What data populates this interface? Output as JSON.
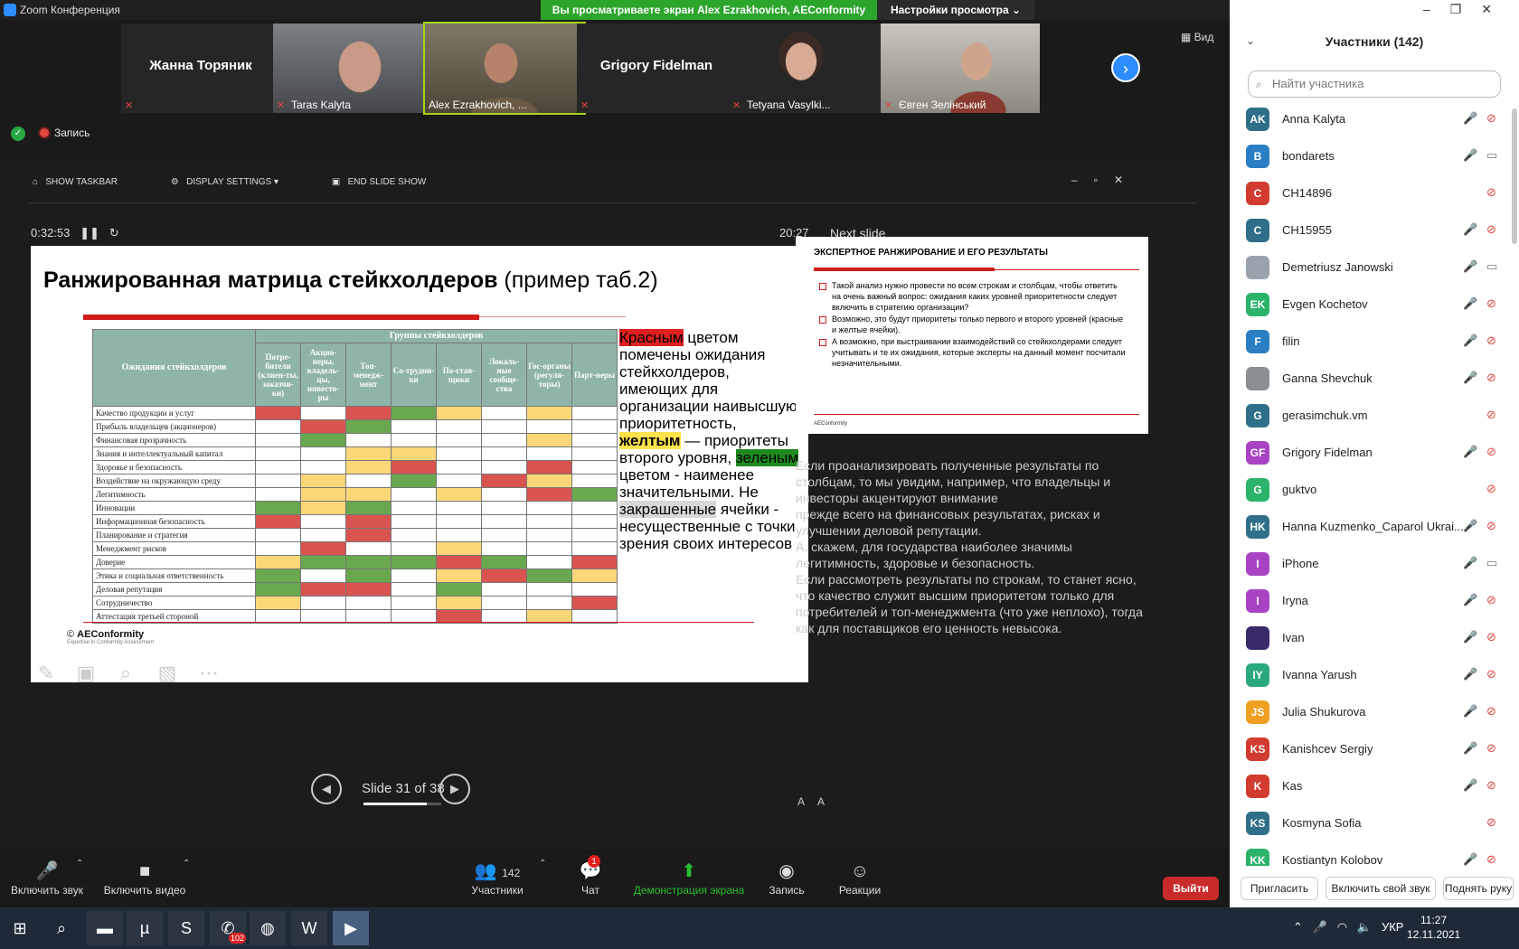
{
  "window": {
    "title": "Zoom Конференция"
  },
  "banner": {
    "viewing": "Вы просматриваете экран Alex Ezrakhovich, AEConformity",
    "view_settings": "Настройки просмотра ⌄"
  },
  "video_strip": {
    "view_label": "Вид",
    "tiles": [
      {
        "name": "Жанна Торяник",
        "caption": "",
        "type": "name"
      },
      {
        "name": "",
        "caption": "Taras Kalyta",
        "type": "photo"
      },
      {
        "name": "",
        "caption": "Alex Ezrakhovich, ...",
        "type": "photo"
      },
      {
        "name": "Grigory Fidelman",
        "caption": "",
        "type": "name"
      },
      {
        "name": "",
        "caption": "Tetyana Vasylki...",
        "type": "photo"
      },
      {
        "name": "",
        "caption": "Євген Зелінський",
        "type": "photo"
      }
    ]
  },
  "recording": {
    "label": "Запись"
  },
  "ppt_toolbar": {
    "show_taskbar": "SHOW TASKBAR",
    "display_settings": "DISPLAY SETTINGS ▾",
    "end_show": "END SLIDE SHOW"
  },
  "presenter": {
    "elapsed": "0:32:53",
    "clock": "20:27",
    "next_label": "Next slide",
    "slide_counter": "Slide 31 of 38",
    "progress": 0.816
  },
  "slide": {
    "title": "Ранжированная матрица стейкхолдеров",
    "title_sub": " (пример таб.2)",
    "table": {
      "row_header": "Ожидания стейкхолдеров",
      "group_header": "Группы стейкхолдеров",
      "columns": [
        "Потре-бители (клиен-ты, заказчи-ки)",
        "Акцио-неры, владель-цы, инвесто-ры",
        "Топ-менедж-мент",
        "Со-трудни-ки",
        "По-став-щики",
        "Локаль-ные сообще-ства",
        "Гос-органы (регуля-торы)",
        "Парт-неры"
      ],
      "rows": [
        {
          "label": "Качество продукции и услуг",
          "cells": "rwrgywyw"
        },
        {
          "label": "Прибыль владельцев (акционеров)",
          "cells": "wrgwwwww"
        },
        {
          "label": "Финансовая прозрачность",
          "cells": "wgwwwwyw"
        },
        {
          "label": "Знания и интеллектуальный капитал",
          "cells": "wwyywwww"
        },
        {
          "label": "Здоровье и безопасность",
          "cells": "wwyrwwrw"
        },
        {
          "label": "Воздействие на окружающую среду",
          "cells": "wywgwryw"
        },
        {
          "label": "Легитимность",
          "cells": "wyywywrg"
        },
        {
          "label": "Инновации",
          "cells": "gygwwwww"
        },
        {
          "label": "Информационная безопасность",
          "cells": "rwrwwwww"
        },
        {
          "label": "Планирование и стратегия",
          "cells": "wwrwwwww"
        },
        {
          "label": "Менеджмент рисков",
          "cells": "wrwwywww"
        },
        {
          "label": "Доверие",
          "cells": "ygggrgwr"
        },
        {
          "label": "Этика и социальная ответственность",
          "cells": "gwgwyrgy"
        },
        {
          "label": "Деловая репутация",
          "cells": "grrwgwww"
        },
        {
          "label": "Сотрудничество",
          "cells": "ywwwywwr"
        },
        {
          "label": "Аттестация третьей стороной",
          "cells": "wwwwrwyw"
        }
      ]
    },
    "legend": {
      "red": "Красным",
      "part1": " цветом помечены ожидания стейкхолдеров, имеющих для организации наивысшую приоритетность, ",
      "yellow": "желтым",
      "part2": " — приоритеты второго уровня, ",
      "green": "зеленым",
      "part3": " цветом - наименее значительными. Не ",
      "gray": "закрашенные",
      "part4": " ячейки - несущественные с точки зрения своих интересов"
    },
    "logo": "AEConformity",
    "logo_tag": "Expertise in Conformity Assessment",
    "logo_prefix": "©"
  },
  "next_slide": {
    "title": "ЭКСПЕРТНОЕ РАНЖИРОВАНИЕ И ЕГО РЕЗУЛЬТАТЫ",
    "bullets": [
      "Такой анализ нужно провести по всем строкам и столбцам, чтобы ответить на очень важный вопрос: ожидания каких уровней приоритетности следует включить в стратегию организации?",
      "Возможно, это будут приоритеты только первого и второго уровней (красные и желтые ячейки).",
      "А возможно, при выстраивании взаимодействий со стейкхолдерами следует учитывать и те их ожидания, которые эксперты на данный момент посчитали незначительными."
    ],
    "logo": "AEConformity"
  },
  "notes": [
    "Если проанализировать полученные результаты по столбцам, то мы увидим, например, что владельцы и инвесторы акцентируют внимание",
    "прежде всего на финансовых результатах, рисках и улучшении деловой репутации.",
    "А, скажем, для государства наиболее значимы легитимность, здоровье и безопасность.",
    "Если рассмотреть результаты по строкам, то станет ясно, что качество служит высшим приоритетом только для потребителей и топ-менеджмента (что уже неплохо), тогда как для поставщиков его ценность невысока."
  ],
  "zoom_bar": {
    "audio": "Включить звук",
    "video": "Включить видео",
    "participants": "Участники",
    "participants_count": "142",
    "chat": "Чат",
    "chat_badge": "1",
    "share": "Демонстрация экрана",
    "record": "Запись",
    "reactions": "Реакции",
    "leave": "Выйти"
  },
  "panel": {
    "title": "Участники (142)",
    "search_placeholder": "Найти участника",
    "participants": [
      {
        "initials": "AK",
        "name": "Anna Kalyta",
        "color": "#2f6f8a",
        "mic": true,
        "cam": "off"
      },
      {
        "initials": "B",
        "name": "bondarets",
        "color": "#2a7fc4",
        "mic": true,
        "cam": "on"
      },
      {
        "initials": "C",
        "name": "CH14896",
        "color": "#d23b2f",
        "mic": false,
        "cam": "off"
      },
      {
        "initials": "C",
        "name": "CH15955",
        "color": "#2f6f8a",
        "mic": true,
        "cam": "off"
      },
      {
        "initials": "",
        "name": "Demetriusz Janowski",
        "color": "#9aa3ad",
        "mic": true,
        "cam": "on"
      },
      {
        "initials": "EK",
        "name": "Evgen Kochetov",
        "color": "#2bb36b",
        "mic": true,
        "cam": "off"
      },
      {
        "initials": "F",
        "name": "filin",
        "color": "#2a7fc4",
        "mic": true,
        "cam": "off"
      },
      {
        "initials": "",
        "name": "Ganna Shevchuk",
        "color": "#8a8f94",
        "mic": true,
        "cam": "off"
      },
      {
        "initials": "G",
        "name": "gerasimchuk.vm",
        "color": "#2f6f8a",
        "mic": false,
        "cam": "off"
      },
      {
        "initials": "GF",
        "name": "Grigory Fidelman",
        "color": "#a844c4",
        "mic": true,
        "cam": "off"
      },
      {
        "initials": "G",
        "name": "guktvo",
        "color": "#2bb36b",
        "mic": false,
        "cam": "off"
      },
      {
        "initials": "HK",
        "name": "Hanna Kuzmenko_Caparol Ukrai...",
        "color": "#2f6f8a",
        "mic": true,
        "cam": "off"
      },
      {
        "initials": "I",
        "name": "iPhone",
        "color": "#a844c4",
        "mic": true,
        "cam": "on"
      },
      {
        "initials": "I",
        "name": "Iryna",
        "color": "#a844c4",
        "mic": true,
        "cam": "off"
      },
      {
        "initials": "",
        "name": "Ivan",
        "color": "#3a2a6a",
        "mic": true,
        "cam": "off"
      },
      {
        "initials": "IY",
        "name": "Ivanna Yarush",
        "color": "#2aa87f",
        "mic": true,
        "cam": "off"
      },
      {
        "initials": "JS",
        "name": "Julia Shukurova",
        "color": "#f0a020",
        "mic": true,
        "cam": "off"
      },
      {
        "initials": "KS",
        "name": "Kanishcev Sergiy",
        "color": "#d23b2f",
        "mic": true,
        "cam": "off"
      },
      {
        "initials": "K",
        "name": "Kas",
        "color": "#d23b2f",
        "mic": true,
        "cam": "off"
      },
      {
        "initials": "KS",
        "name": "Kosmyna Sofia",
        "color": "#2f6f8a",
        "mic": false,
        "cam": "off"
      },
      {
        "initials": "KK",
        "name": "Kostiantyn Kolobov",
        "color": "#2bb36b",
        "mic": true,
        "cam": "off"
      }
    ],
    "footer": {
      "invite": "Пригласить",
      "unmute_self": "Включить свой звук",
      "raise_hand": "Поднять руку"
    }
  },
  "taskbar": {
    "lang": "УКР",
    "time": "11:27",
    "date": "12.11.2021",
    "viber_badge": "102"
  },
  "colors": {
    "zoom_blue": "#2d8cff",
    "banner_green": "#2ca52c",
    "leave_red": "#c92a2a",
    "slide_red": "#d11c1c"
  }
}
